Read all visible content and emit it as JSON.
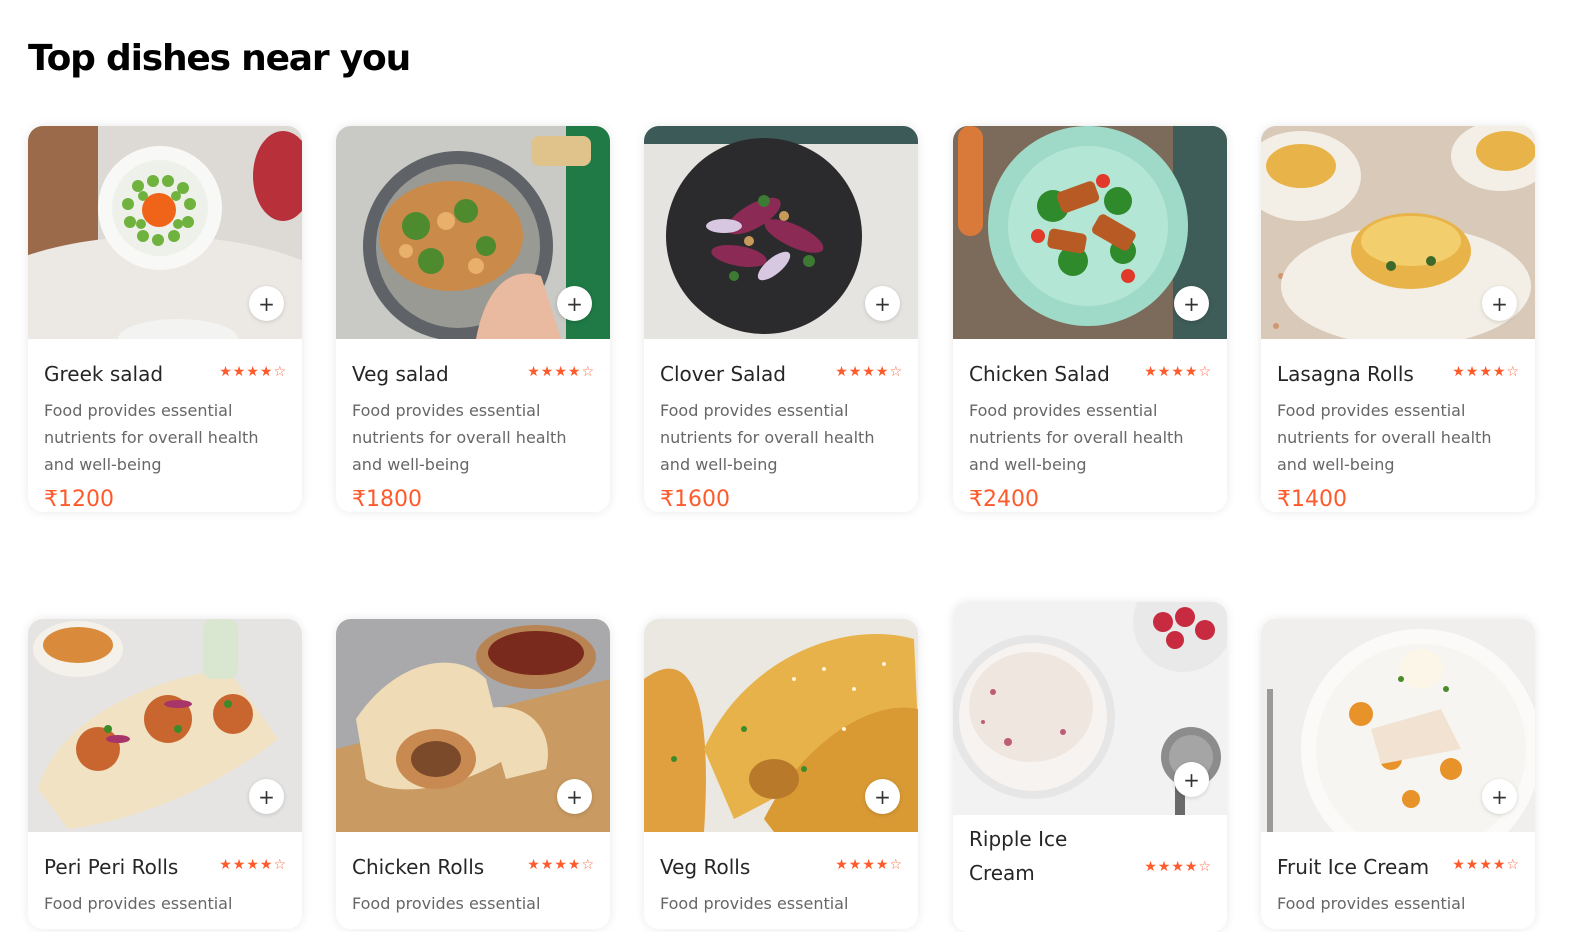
{
  "section_title": "Top dishes near you",
  "add_icon": "+",
  "star_full": "★",
  "star_empty": "☆",
  "accent_color": "#ff5a2b",
  "dishes": [
    {
      "name": "Greek salad",
      "rating": 4,
      "rating_max": 5,
      "desc": "Food provides essential nutrients for overall health and well-being",
      "price": "₹1200"
    },
    {
      "name": "Veg salad",
      "rating": 4,
      "rating_max": 5,
      "desc": "Food provides essential nutrients for overall health and well-being",
      "price": "₹1800"
    },
    {
      "name": "Clover Salad",
      "rating": 4,
      "rating_max": 5,
      "desc": "Food provides essential nutrients for overall health and well-being",
      "price": "₹1600"
    },
    {
      "name": "Chicken Salad",
      "rating": 4,
      "rating_max": 5,
      "desc": "Food provides essential nutrients for overall health and well-being",
      "price": "₹2400"
    },
    {
      "name": "Lasagna Rolls",
      "rating": 4,
      "rating_max": 5,
      "desc": "Food provides essential nutrients for overall health and well-being",
      "price": "₹1400"
    },
    {
      "name": "Peri Peri Rolls",
      "rating": 4,
      "rating_max": 5,
      "desc": "Food provides essential"
    },
    {
      "name": "Chicken Rolls",
      "rating": 4,
      "rating_max": 5,
      "desc": "Food provides essential"
    },
    {
      "name": "Veg Rolls",
      "rating": 4,
      "rating_max": 5,
      "desc": "Food provides essential"
    },
    {
      "name": "Ripple Ice Cream",
      "rating": 4,
      "rating_max": 5
    },
    {
      "name": "Fruit Ice Cream",
      "rating": 4,
      "rating_max": 5,
      "desc": "Food provides essential"
    }
  ]
}
